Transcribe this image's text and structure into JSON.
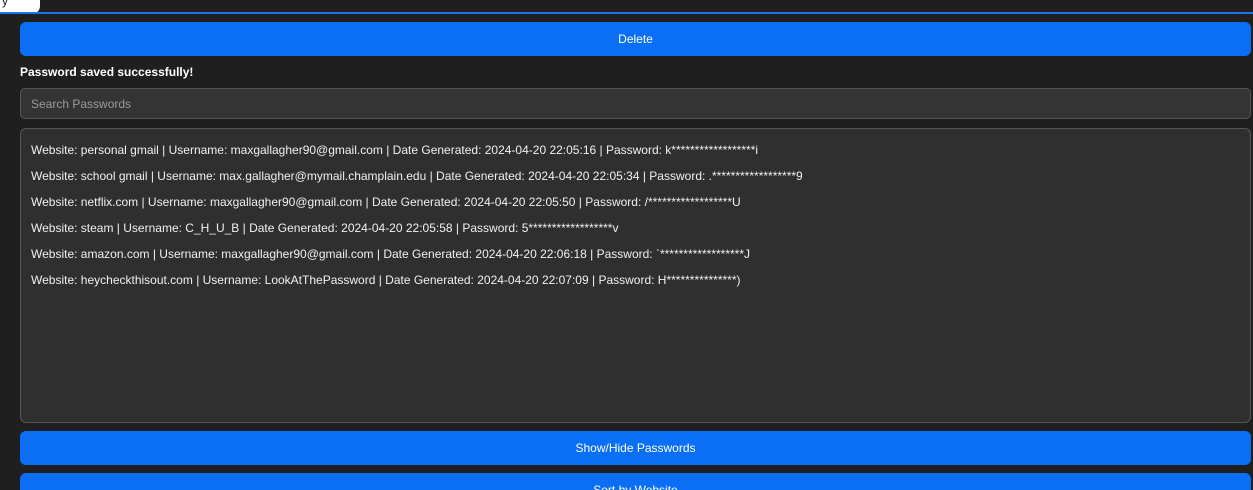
{
  "window": {
    "top_partial_text": "y"
  },
  "buttons": {
    "delete_label": "Delete",
    "toggle_label": "Show/Hide Passwords",
    "sort_label": "Sort by Website"
  },
  "status_message": "Password saved successfully!",
  "search": {
    "placeholder": "Search Passwords",
    "value": ""
  },
  "entries": [
    "Website: personal gmail | Username: maxgallagher90@gmail.com | Date Generated: 2024-04-20 22:05:16 | Password: k******************i",
    "Website: school gmail | Username: max.gallagher@mymail.champlain.edu | Date Generated: 2024-04-20 22:05:34 | Password: .******************9",
    "Website: netflix.com | Username: maxgallagher90@gmail.com | Date Generated: 2024-04-20 22:05:50 | Password: /******************U",
    "Website: steam | Username: C_H_U_B | Date Generated: 2024-04-20 22:05:58 | Password: 5******************v",
    "Website: amazon.com | Username: maxgallagher90@gmail.com | Date Generated: 2024-04-20 22:06:18 | Password: `******************J",
    "Website: heycheckthisout.com | Username: LookAtThePassword | Date Generated: 2024-04-20 22:07:09 | Password: H***************)"
  ],
  "colors": {
    "accent": "#0a6ff5",
    "background": "#1f1f1f",
    "list_background": "#2f2f2f"
  }
}
